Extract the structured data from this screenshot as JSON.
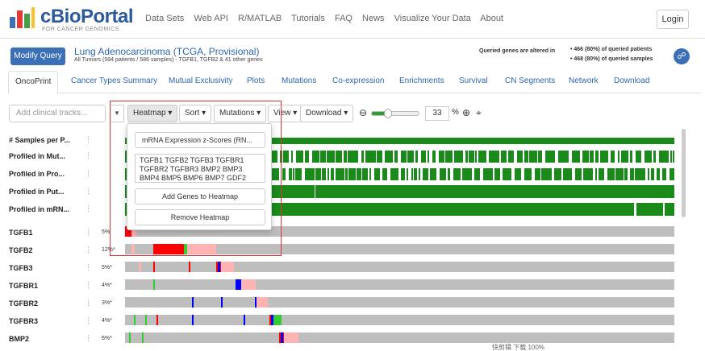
{
  "nav": {
    "logo_title": "cBioPortal",
    "logo_sub": "FOR CANCER GENOMICS",
    "links": [
      "Data Sets",
      "Web API",
      "R/MATLAB",
      "Tutorials",
      "FAQ",
      "News",
      "Visualize Your Data",
      "About"
    ],
    "login": "Login"
  },
  "study": {
    "modify_button": "Modify Query",
    "title": "Lung Adenocarcinoma (TCGA, Provisional)",
    "subtitle": "All Tumors (584 patients / 586 samples) - TGFB1, TGFB2 & 41 other genes",
    "altered_label": "Queried genes are altered in",
    "altered_patients": "• 466 (80%) of queried patients",
    "altered_samples": "• 468 (80%) of queried samples"
  },
  "tabs": [
    "OncoPrint",
    "Cancer Types Summary",
    "Mutual Exclusivity",
    "Plots",
    "Mutations",
    "Co-expression",
    "Enrichments",
    "Survival",
    "CN Segments",
    "Network",
    "Download"
  ],
  "toolbar": {
    "clinical_placeholder": "Add clinical tracks...",
    "heatmap": "Heatmap ▾",
    "sort": "Sort ▾",
    "mutations": "Mutations ▾",
    "view": "View ▾",
    "download": "Download ▾",
    "zoom_value": "33",
    "zoom_unit": "%",
    "zoom_fraction": 0.33
  },
  "popup": {
    "profile_select": "mRNA Expression z-Scores (RN...",
    "genes_text": "TGFB1 TGFB2 TGFB3 TGFBR1 TGFBR2 TGFBR3 BMP2 BMP3 BMP4 BMP5 BMP6 BMP7 GDF2",
    "add_button": "Add Genes to Heatmap",
    "remove_button": "Remove Heatmap"
  },
  "clinical_tracks": [
    {
      "label": "# Samples per P..."
    },
    {
      "label": "Profiled in Mut..."
    },
    {
      "label": "Profiled in Pro..."
    },
    {
      "label": "Profiled in Put..."
    },
    {
      "label": "Profiled in mRN..."
    }
  ],
  "gene_tracks": [
    {
      "gene": "TGFB1",
      "pct": "5%"
    },
    {
      "gene": "TGFB2",
      "pct": "12%*"
    },
    {
      "gene": "TGFB3",
      "pct": "5%*"
    },
    {
      "gene": "TGFBR1",
      "pct": "4%*"
    },
    {
      "gene": "TGFBR2",
      "pct": "3%*"
    },
    {
      "gene": "TGFBR3",
      "pct": "4%*"
    },
    {
      "gene": "BMP2",
      "pct": "6%*"
    }
  ],
  "colors": {
    "profiled": "#1a8a1a",
    "amplification": "#ff0000",
    "mrna_up": "#ffb3b3",
    "deletion": "#0000ff",
    "mutation": "#33cc33",
    "unaltered": "#bebebe"
  },
  "status_bar": "快剪辑  下载  100%"
}
